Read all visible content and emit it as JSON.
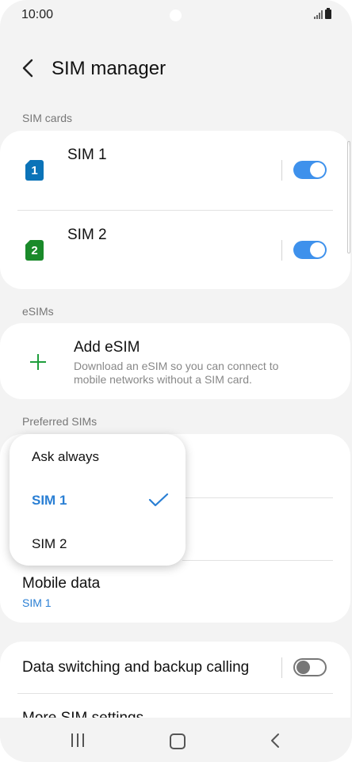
{
  "status_bar": {
    "time": "10:00"
  },
  "header": {
    "title": "SIM manager"
  },
  "sim_cards": {
    "section_label": "SIM cards",
    "items": [
      {
        "badge": "1",
        "name": "SIM 1",
        "enabled": true,
        "color": "#0b73b8"
      },
      {
        "badge": "2",
        "name": "SIM 2",
        "enabled": true,
        "color": "#1a8a2a"
      }
    ]
  },
  "esims": {
    "section_label": "eSIMs",
    "add_title": "Add eSIM",
    "add_description": "Download an eSIM so you can connect to mobile networks without a SIM card."
  },
  "preferred": {
    "section_label": "Preferred SIMs",
    "mobile_data": {
      "title": "Mobile data",
      "value": "SIM 1"
    }
  },
  "popup": {
    "options": [
      "Ask always",
      "SIM 1",
      "SIM 2"
    ],
    "selected": "SIM 1"
  },
  "bottom_card": {
    "data_switching": {
      "label": "Data switching and backup calling",
      "enabled": false
    },
    "more_settings": "More SIM settings"
  },
  "colors": {
    "accent": "#3e91ec",
    "link": "#2a7fd4",
    "background": "#f3f3f3"
  }
}
